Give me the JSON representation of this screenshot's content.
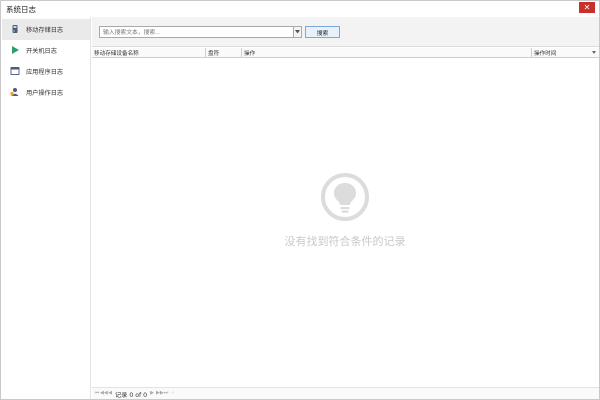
{
  "window": {
    "title": "系统日志",
    "close_icon": "close-icon"
  },
  "sidebar": {
    "items": [
      {
        "label": "移动存储日志",
        "icon": "usb-storage-icon",
        "active": true
      },
      {
        "label": "开关机日志",
        "icon": "play-icon",
        "active": false
      },
      {
        "label": "应用程序日志",
        "icon": "application-window-icon",
        "active": false
      },
      {
        "label": "用户操作日志",
        "icon": "user-icon",
        "active": false
      }
    ]
  },
  "search": {
    "placeholder": "输入搜索文本，搜索...",
    "button_label": "搜索"
  },
  "table": {
    "columns": [
      "移动存储设备名称",
      "盘符",
      "操作",
      "操作时间"
    ]
  },
  "empty_state": {
    "message": "没有找到符合条件的记录",
    "icon": "lightbulb-icon"
  },
  "pager": {
    "text": "记录 0 of 0",
    "icons": [
      "first-page-icon",
      "prev-page-group-icon",
      "prev-page-icon",
      "next-page-icon",
      "next-page-group-icon",
      "last-page-icon",
      "scroll-left-icon"
    ]
  },
  "colors": {
    "close_button": "#c9302c",
    "sidebar_active": "#eaeaea",
    "search_button_border": "#7aa8d8",
    "play_icon": "#2e9e6e",
    "empty_state": "#c8c8c8"
  }
}
